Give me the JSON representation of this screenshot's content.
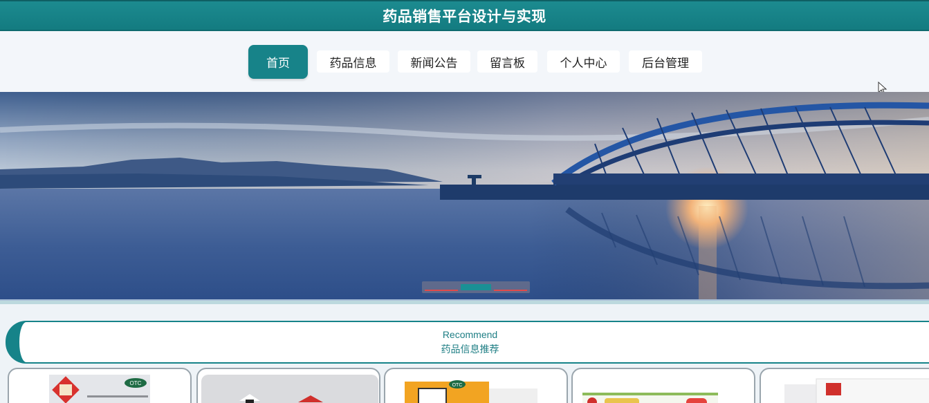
{
  "header": {
    "title": "药品销售平台设计与实现"
  },
  "nav": {
    "items": [
      {
        "label": "首页",
        "active": true
      },
      {
        "label": "药品信息",
        "active": false
      },
      {
        "label": "新闻公告",
        "active": false
      },
      {
        "label": "留言板",
        "active": false
      },
      {
        "label": "个人中心",
        "active": false
      },
      {
        "label": "后台管理",
        "active": false
      }
    ]
  },
  "banner": {
    "slide_count": 3,
    "active_slide": 1
  },
  "recommend": {
    "title_en": "Recommend",
    "title_cn": "药品信息推荐"
  },
  "products": [
    {
      "icon": "medicine-box-image",
      "badge": "OTC"
    },
    {
      "icon": "medicine-box-image"
    },
    {
      "icon": "medicine-box-image",
      "badge": "OTC"
    },
    {
      "icon": "medicine-box-image"
    },
    {
      "icon": "medicine-box-image"
    }
  ],
  "colors": {
    "accent": "#178389",
    "title_bar": "#1c8b90",
    "background": "#eef3f7"
  }
}
